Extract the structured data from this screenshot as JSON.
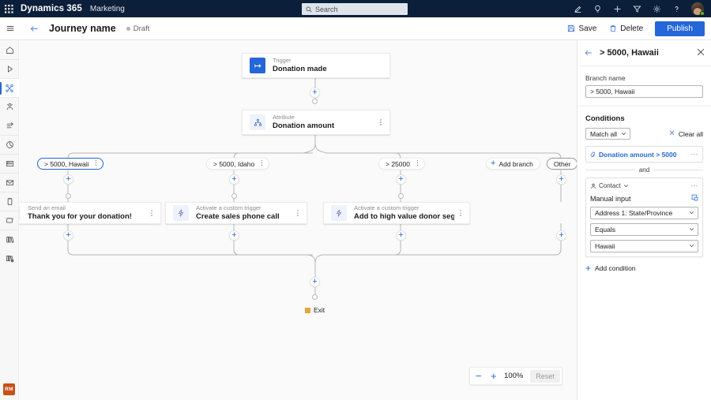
{
  "suite": {
    "product": "Dynamics 365",
    "module": "Marketing",
    "search_placeholder": "Search",
    "icons": [
      "edit-icon",
      "lightbulb-icon",
      "plus-icon",
      "filter-icon",
      "gear-icon",
      "help-icon"
    ],
    "avatar_name": "user-avatar"
  },
  "command_bar": {
    "journey_title": "Journey name",
    "status": "Draft",
    "save_label": "Save",
    "delete_label": "Delete",
    "publish_label": "Publish"
  },
  "left_rail": {
    "items": [
      {
        "name": "home",
        "active": false,
        "sep": false
      },
      {
        "name": "run",
        "active": false,
        "sep": true
      },
      {
        "name": "journeys",
        "active": true,
        "sep": true
      },
      {
        "name": "segments",
        "active": false,
        "sep": true
      },
      {
        "name": "triggers",
        "active": false,
        "sep": false
      },
      {
        "name": "analytics",
        "active": false,
        "sep": true
      },
      {
        "name": "forms",
        "active": false,
        "sep": true
      },
      {
        "name": "emails",
        "active": false,
        "sep": true
      },
      {
        "name": "text-messages",
        "active": false,
        "sep": true
      },
      {
        "name": "push-notifications",
        "active": false,
        "sep": true
      },
      {
        "name": "assets",
        "active": false,
        "sep": true
      },
      {
        "name": "reports",
        "active": false,
        "sep": false
      }
    ],
    "badge": "RM"
  },
  "canvas": {
    "trigger_node": {
      "subtitle": "Trigger",
      "title": "Donation made",
      "icon": "trigger-icon"
    },
    "attribute_node": {
      "subtitle": "Attribute",
      "title": "Donation amount",
      "icon": "attribute-branch-icon"
    },
    "branches": [
      {
        "label": "> 5000, Hawaii",
        "selected": true
      },
      {
        "label": "> 5000, Idaho",
        "selected": false
      },
      {
        "label": "> 25000",
        "selected": false
      }
    ],
    "add_branch_label": "Add branch",
    "other_label": "Other",
    "action_cards": [
      {
        "subtitle": "Send an email",
        "title": "Thank you for your donation!",
        "icon": "email-icon"
      },
      {
        "subtitle": "Activate a custom trigger",
        "title": "Create sales phone call",
        "icon": "custom-trigger-icon"
      },
      {
        "subtitle": "Activate a custom trigger",
        "title": "Add to high value donor segment",
        "icon": "custom-trigger-icon"
      }
    ],
    "exit_label": "Exit",
    "zoom": {
      "level": "100%",
      "reset_label": "Reset"
    }
  },
  "right_panel": {
    "title": "> 5000, Hawaii",
    "branch_name_label": "Branch name",
    "branch_name_value": "> 5000, Hawaii",
    "conditions_label": "Conditions",
    "match_label": "Match all",
    "clear_all_label": "Clear all",
    "condition_pill": "Donation amount > 5000",
    "and_label": "and",
    "entity_label": "Contact",
    "manual_input_label": "Manual input",
    "selects": [
      "Address 1: State/Province",
      "Equals",
      "Hawaii"
    ],
    "add_condition_label": "Add condition"
  },
  "colors": {
    "suite_bar": "#0b1f3a",
    "accent": "#2566d8",
    "canvas_bg": "#fafafa",
    "exit_flag": "#e8a33d",
    "badge": "#c8501a"
  }
}
